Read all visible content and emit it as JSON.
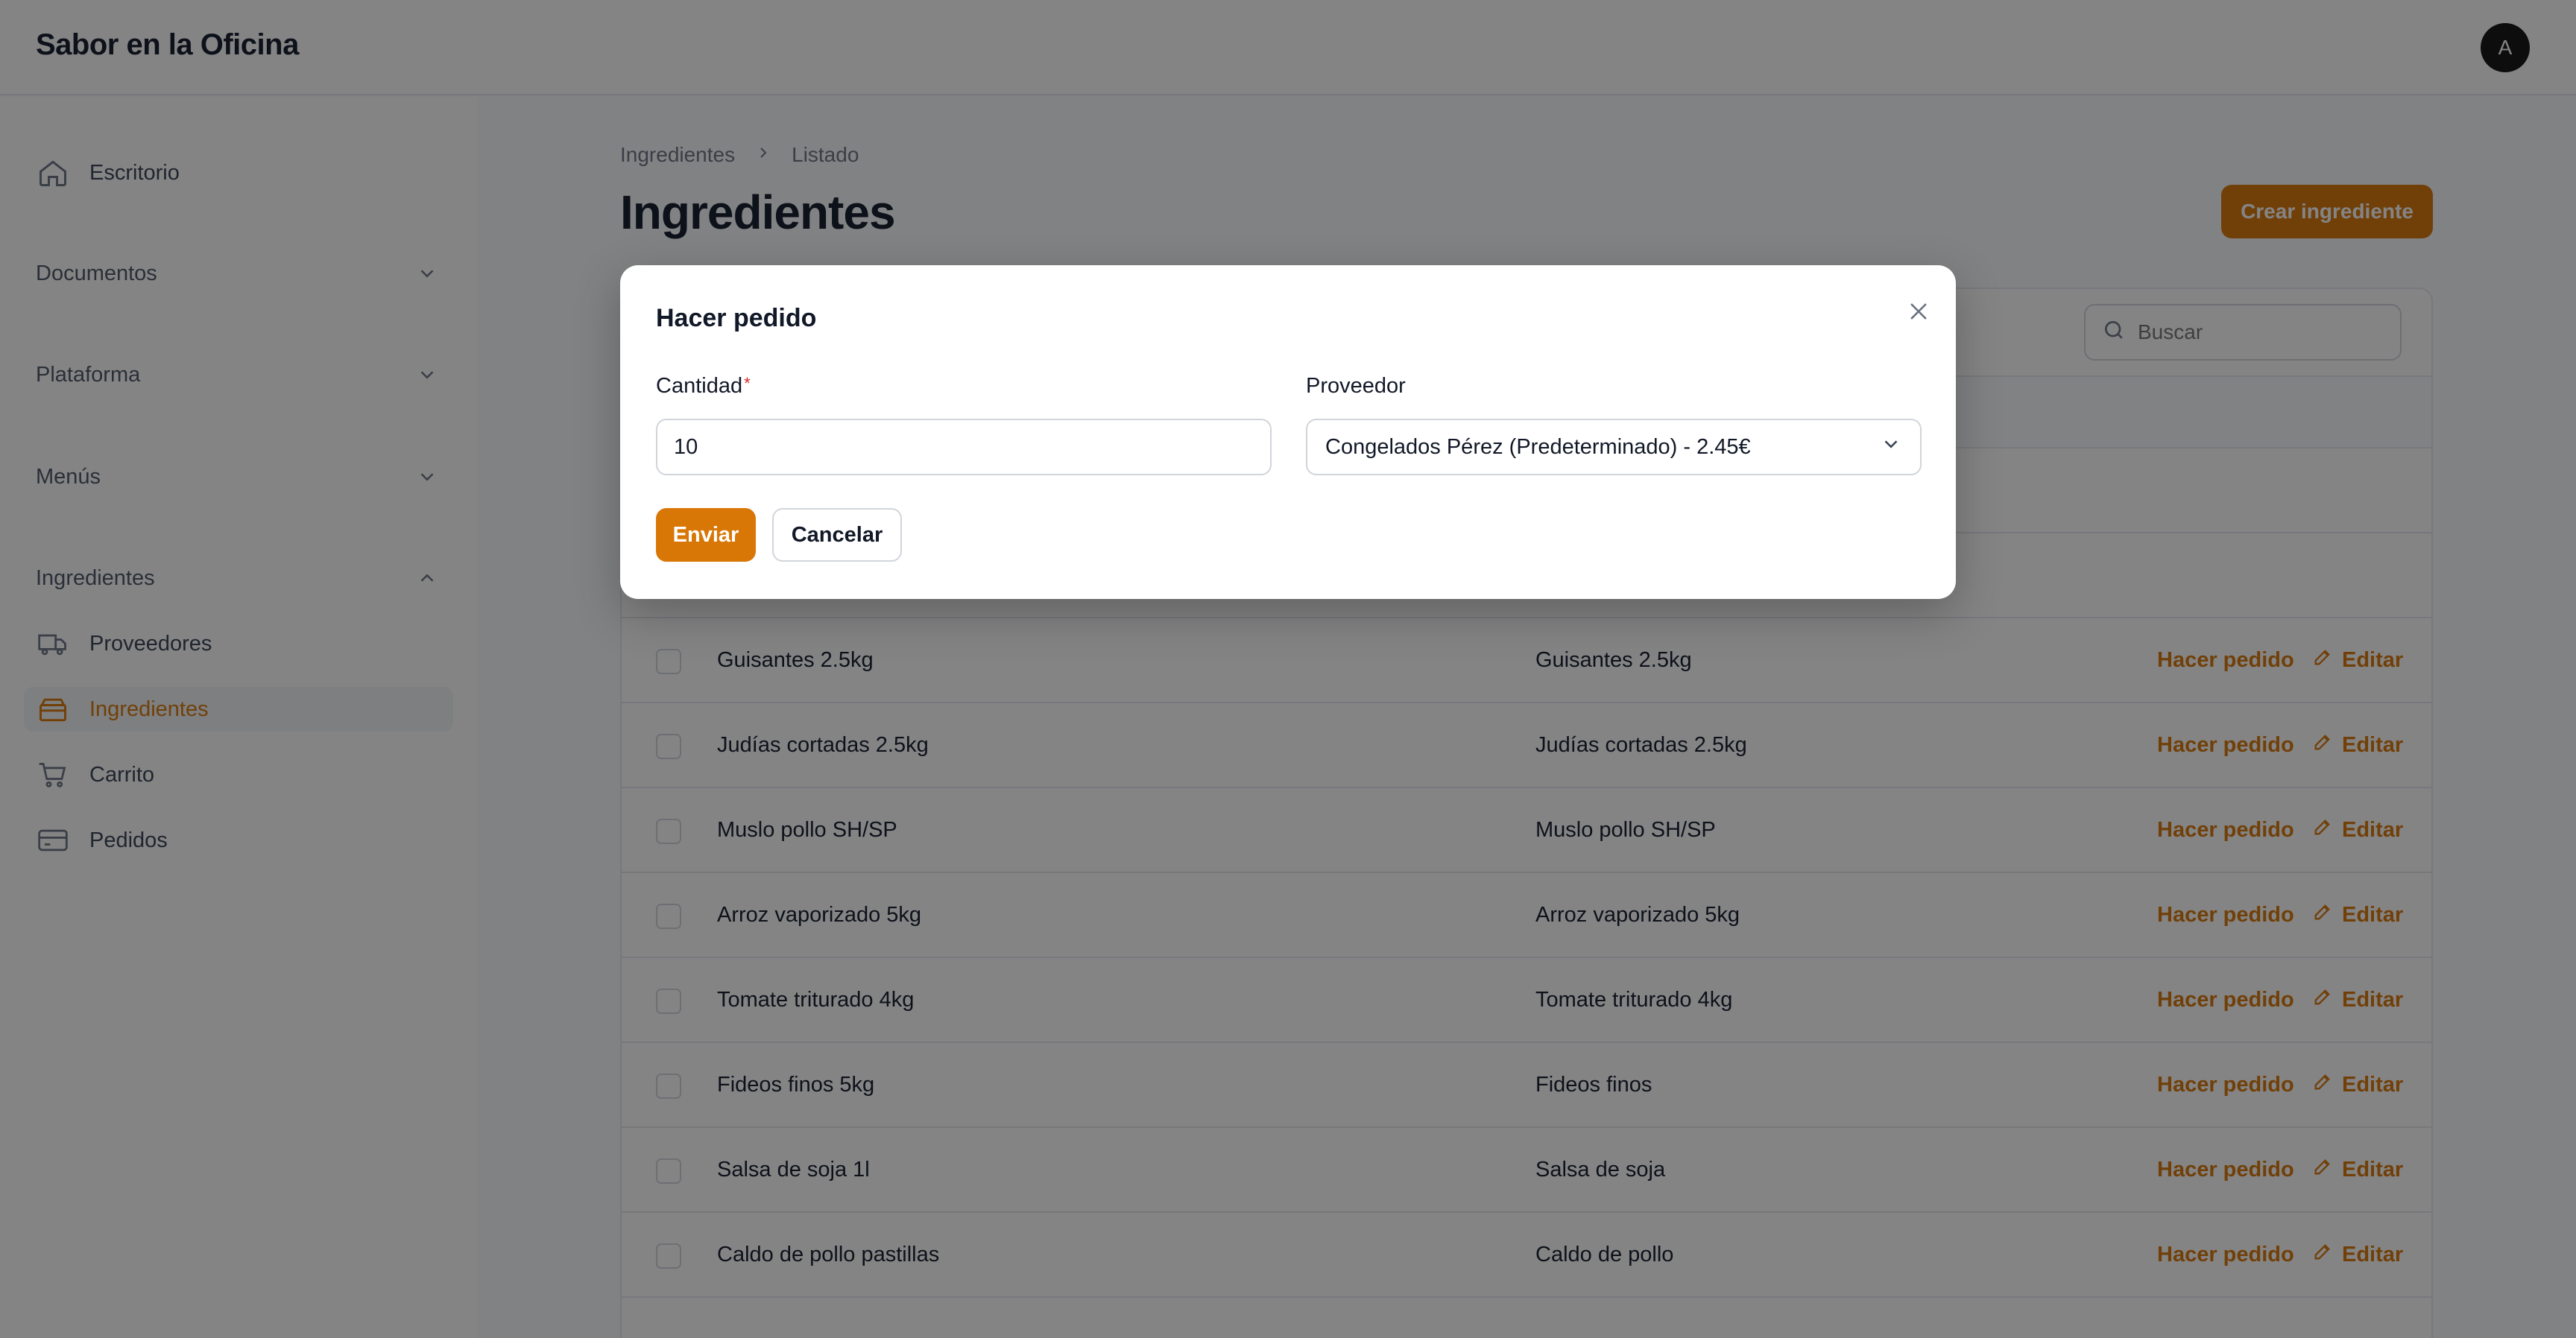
{
  "app": {
    "title": "Sabor en la Oficina",
    "avatar_initial": "A"
  },
  "sidebar": {
    "escritorio": "Escritorio",
    "groups": {
      "documentos": "Documentos",
      "plataforma": "Plataforma",
      "menus": "Menús",
      "ingredientes": "Ingredientes"
    },
    "items": {
      "proveedores": "Proveedores",
      "ingredientes": "Ingredientes",
      "carrito": "Carrito",
      "pedidos": "Pedidos"
    },
    "active_item": "Ingredientes"
  },
  "breadcrumb": {
    "parent": "Ingredientes",
    "current": "Listado"
  },
  "page": {
    "title": "Ingredientes",
    "create_label": "Crear ingrediente"
  },
  "search": {
    "placeholder": "Buscar"
  },
  "table": {
    "action_order": "Hacer pedido",
    "action_edit": "Editar",
    "rows": [
      {
        "name": "Guisantes 2.5kg",
        "alias": "Guisantes 2.5kg"
      },
      {
        "name": "Judías cortadas 2.5kg",
        "alias": "Judías cortadas 2.5kg"
      },
      {
        "name": "Muslo pollo SH/SP",
        "alias": "Muslo pollo SH/SP"
      },
      {
        "name": "Arroz vaporizado 5kg",
        "alias": "Arroz vaporizado 5kg"
      },
      {
        "name": "Tomate triturado 4kg",
        "alias": "Tomate triturado 4kg"
      },
      {
        "name": "Fideos finos 5kg",
        "alias": "Fideos finos"
      },
      {
        "name": "Salsa de soja 1l",
        "alias": "Salsa de soja"
      },
      {
        "name": "Caldo de pollo pastillas",
        "alias": "Caldo de pollo"
      }
    ]
  },
  "modal": {
    "title": "Hacer pedido",
    "cantidad_label": "Cantidad",
    "required_mark": "*",
    "cantidad_value": "10",
    "proveedor_label": "Proveedor",
    "proveedor_value": "Congelados Pérez (Predeterminado) - 2.45€",
    "submit_label": "Enviar",
    "cancel_label": "Cancelar"
  },
  "colors": {
    "accent": "#d97706",
    "required": "#dc2626"
  }
}
